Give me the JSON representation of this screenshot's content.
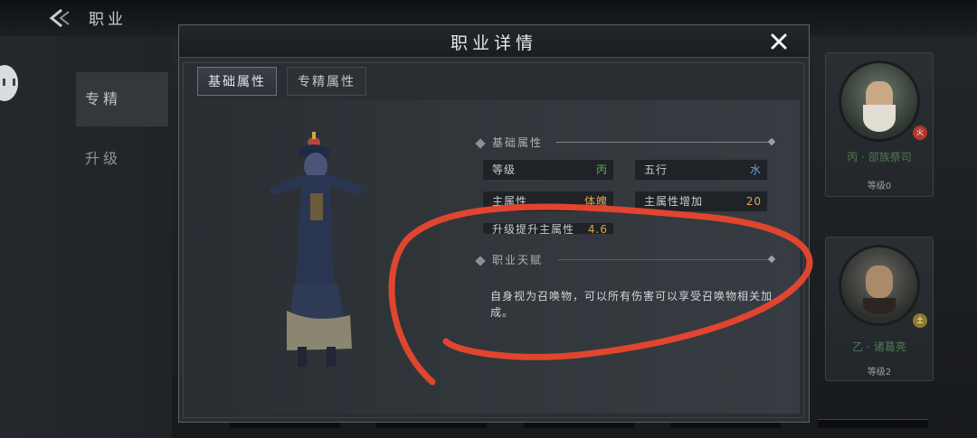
{
  "background": {
    "page_title": "职业",
    "side_tabs": [
      {
        "label": "专精",
        "active": true
      },
      {
        "label": "升级",
        "active": false
      }
    ],
    "cards": [
      {
        "name": "丙 · 部族祭司",
        "level": "等级0",
        "badge": "火"
      },
      {
        "name": "乙 · 诸葛亮",
        "level": "等级2",
        "badge": "土"
      }
    ]
  },
  "modal": {
    "title": "职业详情",
    "tabs": [
      {
        "label": "基础属性",
        "active": true
      },
      {
        "label": "专精属性",
        "active": false
      }
    ],
    "basic_section": {
      "heading": "基础属性",
      "attributes": [
        {
          "label": "等级",
          "value": "丙",
          "color": "#5fae5a"
        },
        {
          "label": "五行",
          "value": "水",
          "color": "#5aa6e0"
        },
        {
          "label": "主属性",
          "value": "体魄",
          "color": "#e0a24a"
        },
        {
          "label": "主属性增加",
          "value": "20",
          "color": "#e0a24a"
        },
        {
          "label": "升级提升主属性",
          "value": "4.6",
          "color": "#e0a24a"
        }
      ]
    },
    "talent_section": {
      "heading": "职业天赋",
      "text": "自身视为召唤物，可以所有伤害可以享受召唤物相关加成。"
    }
  },
  "annotation": {
    "color": "#e0452f"
  }
}
